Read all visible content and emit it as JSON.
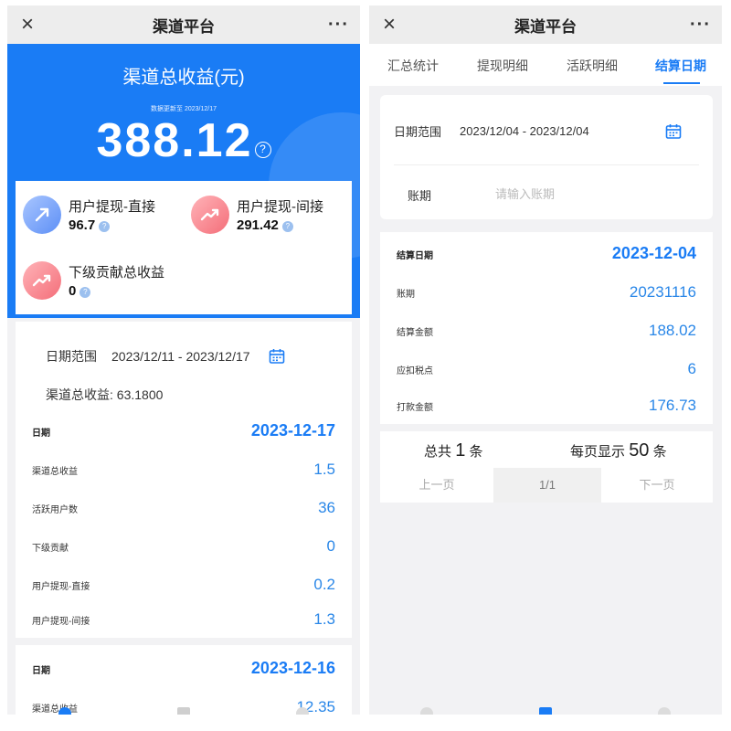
{
  "left": {
    "titlebar": {
      "close_icon": "×",
      "title": "渠道平台",
      "more_icon": "···"
    },
    "hero": {
      "title": "渠道总收益(元)",
      "update_note": "数据更新至 2023/12/17",
      "total": "388.12",
      "help_icon": "?"
    },
    "stats": [
      {
        "label": "用户提现-直接",
        "value": "96.7",
        "icon": "trend-up-icon",
        "color": "#5d8ff6"
      },
      {
        "label": "用户提现-间接",
        "value": "291.42",
        "icon": "trend-up-icon",
        "color": "#f46e79"
      },
      {
        "label": "下级贡献总收益",
        "value": "0",
        "icon": "trend-up-icon",
        "color": "#f46e79"
      }
    ],
    "filter": {
      "date_label": "日期范围",
      "date_value": "2023/12/11 - 2023/12/17",
      "summary": "渠道总收益: 63.1800"
    },
    "records": [
      {
        "rows": [
          {
            "k": "日期",
            "v": "2023-12-17"
          },
          {
            "k": "渠道总收益",
            "v": "1.5"
          },
          {
            "k": "活跃用户数",
            "v": "36"
          },
          {
            "k": "下级贡献",
            "v": "0"
          },
          {
            "k": "用户提现-直接",
            "v": "0.2"
          },
          {
            "k": "用户提现-间接",
            "v": "1.3"
          }
        ]
      },
      {
        "rows": [
          {
            "k": "日期",
            "v": "2023-12-16"
          },
          {
            "k": "渠道总收益",
            "v": "12.35"
          }
        ]
      }
    ]
  },
  "right": {
    "titlebar": {
      "close_icon": "×",
      "title": "渠道平台",
      "more_icon": "···"
    },
    "tabs": [
      {
        "label": "汇总统计",
        "active": false
      },
      {
        "label": "提现明细",
        "active": false
      },
      {
        "label": "活跃明细",
        "active": false
      },
      {
        "label": "结算日期",
        "active": true
      }
    ],
    "form": {
      "date_label": "日期范围",
      "date_value": "2023/12/04 - 2023/12/04",
      "period_label": "账期",
      "period_placeholder": "请输入账期",
      "period_value": ""
    },
    "record": {
      "rows": [
        {
          "k": "结算日期",
          "v": "2023-12-04"
        },
        {
          "k": "账期",
          "v": "20231116"
        },
        {
          "k": "结算金额",
          "v": "188.02"
        },
        {
          "k": "应扣税点",
          "v": "6"
        },
        {
          "k": "打款金额",
          "v": "176.73"
        }
      ]
    },
    "pager": {
      "total_prefix": "总共",
      "total_count": "1",
      "total_suffix": "条",
      "per_page_prefix": "每页显示",
      "per_page_count": "50",
      "per_page_suffix": "条",
      "prev": "上一页",
      "current": "1/1",
      "next": "下一页"
    }
  },
  "colors": {
    "accent": "#1a7cf5",
    "value_blue": "#2a87e8",
    "page_bg": "#f2f2f4"
  }
}
